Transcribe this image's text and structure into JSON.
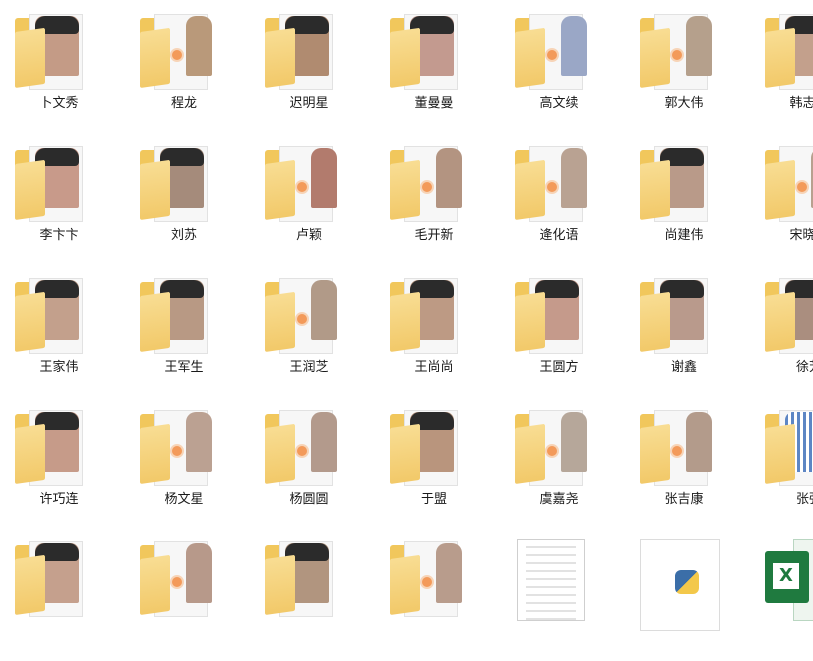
{
  "items": [
    {
      "label": "卜文秀",
      "kind": "folder-photo",
      "photo_color": "#c49b86"
    },
    {
      "label": "程龙",
      "kind": "folder-badge",
      "photo_color": "#b9997a"
    },
    {
      "label": "迟明星",
      "kind": "folder-photo",
      "photo_color": "#b08b70"
    },
    {
      "label": "董曼曼",
      "kind": "folder-photo",
      "photo_color": "#c39a8f"
    },
    {
      "label": "高文续",
      "kind": "folder-badge",
      "photo_color": "#9aa7c6"
    },
    {
      "label": "郭大伟",
      "kind": "folder-badge",
      "photo_color": "#b5a08c"
    },
    {
      "label": "韩志杰",
      "kind": "folder-photo",
      "photo_color": "#c3a08c"
    },
    {
      "label": "李卞卞",
      "kind": "folder-photo",
      "photo_color": "#c89a8a"
    },
    {
      "label": "刘苏",
      "kind": "folder-photo",
      "photo_color": "#a58b7b"
    },
    {
      "label": "卢颖",
      "kind": "folder-badge",
      "photo_color": "#b27b6d"
    },
    {
      "label": "毛开新",
      "kind": "folder-badge",
      "photo_color": "#b39481"
    },
    {
      "label": "逄化语",
      "kind": "folder-badge",
      "photo_color": "#b9a292"
    },
    {
      "label": "尚建伟",
      "kind": "folder-photo",
      "photo_color": "#b99a89"
    },
    {
      "label": "宋晓洁",
      "kind": "folder-badge",
      "photo_color": "#b8a08f"
    },
    {
      "label": "王家伟",
      "kind": "folder-photo",
      "photo_color": "#c3a08c"
    },
    {
      "label": "王军生",
      "kind": "folder-photo",
      "photo_color": "#b89984"
    },
    {
      "label": "王润芝",
      "kind": "folder-badge",
      "photo_color": "#b19a88"
    },
    {
      "label": "王尚尚",
      "kind": "folder-photo",
      "photo_color": "#bd9a84"
    },
    {
      "label": "王圆方",
      "kind": "folder-photo",
      "photo_color": "#c59a8b"
    },
    {
      "label": "谢鑫",
      "kind": "folder-photo",
      "photo_color": "#b99a8c"
    },
    {
      "label": "徐芳",
      "kind": "folder-photo",
      "photo_color": "#aa8e7f"
    },
    {
      "label": "许巧连",
      "kind": "folder-photo",
      "photo_color": "#c69b89"
    },
    {
      "label": "杨文星",
      "kind": "folder-badge",
      "photo_color": "#bba192"
    },
    {
      "label": "杨圆圆",
      "kind": "folder-badge",
      "photo_color": "#b39a8c"
    },
    {
      "label": "于盟",
      "kind": "folder-photo",
      "photo_color": "#b9957d"
    },
    {
      "label": "虞嘉尧",
      "kind": "folder-badge",
      "photo_color": "#b6a79a"
    },
    {
      "label": "张吉康",
      "kind": "folder-badge",
      "photo_color": "#b39b8b"
    },
    {
      "label": "张强",
      "kind": "folder-qr",
      "photo_color": "#5d86c4"
    },
    {
      "label": "",
      "kind": "folder-photo",
      "photo_color": "#c5a08d"
    },
    {
      "label": "",
      "kind": "folder-badge",
      "photo_color": "#b7998a"
    },
    {
      "label": "",
      "kind": "folder-photo",
      "photo_color": "#b1957f"
    },
    {
      "label": "",
      "kind": "folder-badge",
      "photo_color": "#b89c8c"
    },
    {
      "label": "",
      "kind": "doc",
      "photo_color": "#ffffff"
    },
    {
      "label": "",
      "kind": "python",
      "photo_color": "#ffffff"
    },
    {
      "label": "",
      "kind": "excel",
      "photo_color": "#1f7a3f"
    }
  ]
}
